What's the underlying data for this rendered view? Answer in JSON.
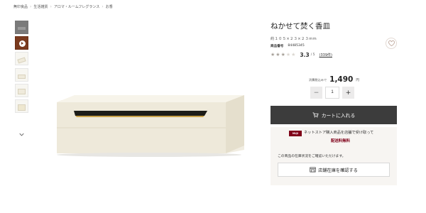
{
  "breadcrumb": [
    "無印良品",
    "生活雑貨",
    "アロマ・ルームフレグランス",
    "お香"
  ],
  "product": {
    "title": "ねかせて焚く香皿",
    "size": "約１０５×２３×２３mm",
    "number_label": "商品番号",
    "number": "84485345",
    "rating": {
      "score": "3.3",
      "max": "/ 5",
      "count": "(339件)",
      "stars_filled": 3,
      "stars_total": 5
    },
    "price": {
      "tax_label": "消費税込みで",
      "amount": "1,490",
      "unit": "円"
    }
  },
  "quantity": {
    "value": "1",
    "minus": "−",
    "plus": "+"
  },
  "cart_button": "カートに入れる",
  "store_pickup": {
    "tag": "MUJI",
    "text": "ネットストア購入商品を店舗で受け取って",
    "free": "配送料無料"
  },
  "stock": {
    "note": "この商品の在庫状況をご確認いただけます。",
    "button": "店舗在庫を確認する"
  },
  "icons": [
    "play-icon",
    "chevron-down-icon",
    "heart-icon",
    "cart-icon",
    "store-icon"
  ],
  "colors": {
    "cart_button": "#3c3c3c",
    "accent": "#7f0019",
    "panel": "#f7f5f2"
  }
}
